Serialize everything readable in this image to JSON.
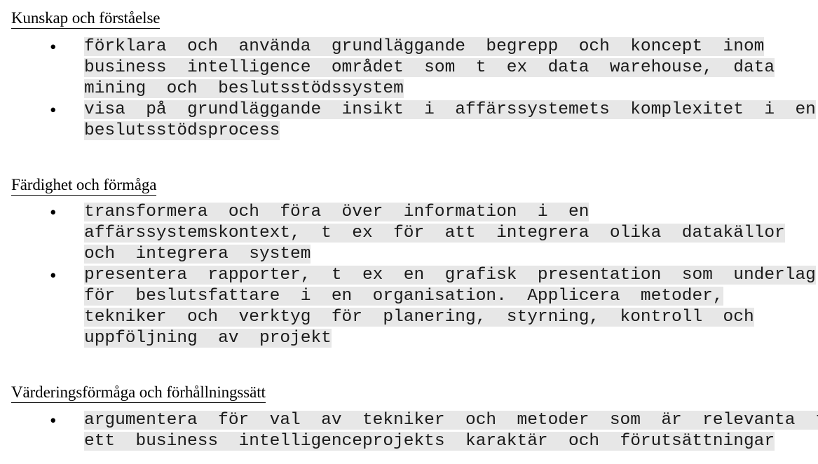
{
  "document": {
    "language": "sv",
    "bullet_glyph": "•",
    "highlight_color": "#e7e7e7",
    "text_color": "#1a1a1a",
    "heading_color": "#000000"
  },
  "sections": [
    {
      "id": "kunskap-och-forstaelse",
      "heading": "Kunskap och förståelse",
      "bullets": [
        {
          "id": "bullet-forklara-anvanda",
          "lines": [
            "förklara  och  använda  grundläggande  begrepp  och  koncept  inom",
            "business  intelligence  området  som  t  ex  data  warehouse,  data",
            "mining  och  beslutsstödssystem"
          ]
        },
        {
          "id": "bullet-visa-insikt",
          "lines": [
            "visa  på  grundläggande  insikt  i  affärssystemets  komplexitet  i  en",
            "beslutsstödsprocess"
          ]
        }
      ]
    },
    {
      "id": "fardighet-och-formaga",
      "heading": "Färdighet och förmåga",
      "bullets": [
        {
          "id": "bullet-transformera-information",
          "lines": [
            "transformera  och  föra  över  information  i  en",
            "affärssystemskontext,  t  ex  för  att  integrera  olika  datakällor",
            "och  integrera  system"
          ]
        },
        {
          "id": "bullet-presentera-rapporter",
          "lines": [
            "presentera  rapporter,  t  ex  en  grafisk  presentation  som  underlag",
            "för  beslutsfattare  i  en  organisation.  Applicera  metoder,",
            "tekniker  och  verktyg  för  planering,  styrning,  kontroll  och",
            "uppföljning  av  projekt"
          ]
        }
      ]
    },
    {
      "id": "varderingsformaga-och-forhallningssatt",
      "heading": "Värderingsförmåga och förhållningssätt",
      "bullets": [
        {
          "id": "bullet-argumentera-val",
          "lines": [
            "argumentera  för  val  av  tekniker  och  metoder  som  är  relevanta  för",
            "ett  business  intelligenceprojekts  karaktär  och  förutsättningar"
          ]
        }
      ]
    }
  ]
}
